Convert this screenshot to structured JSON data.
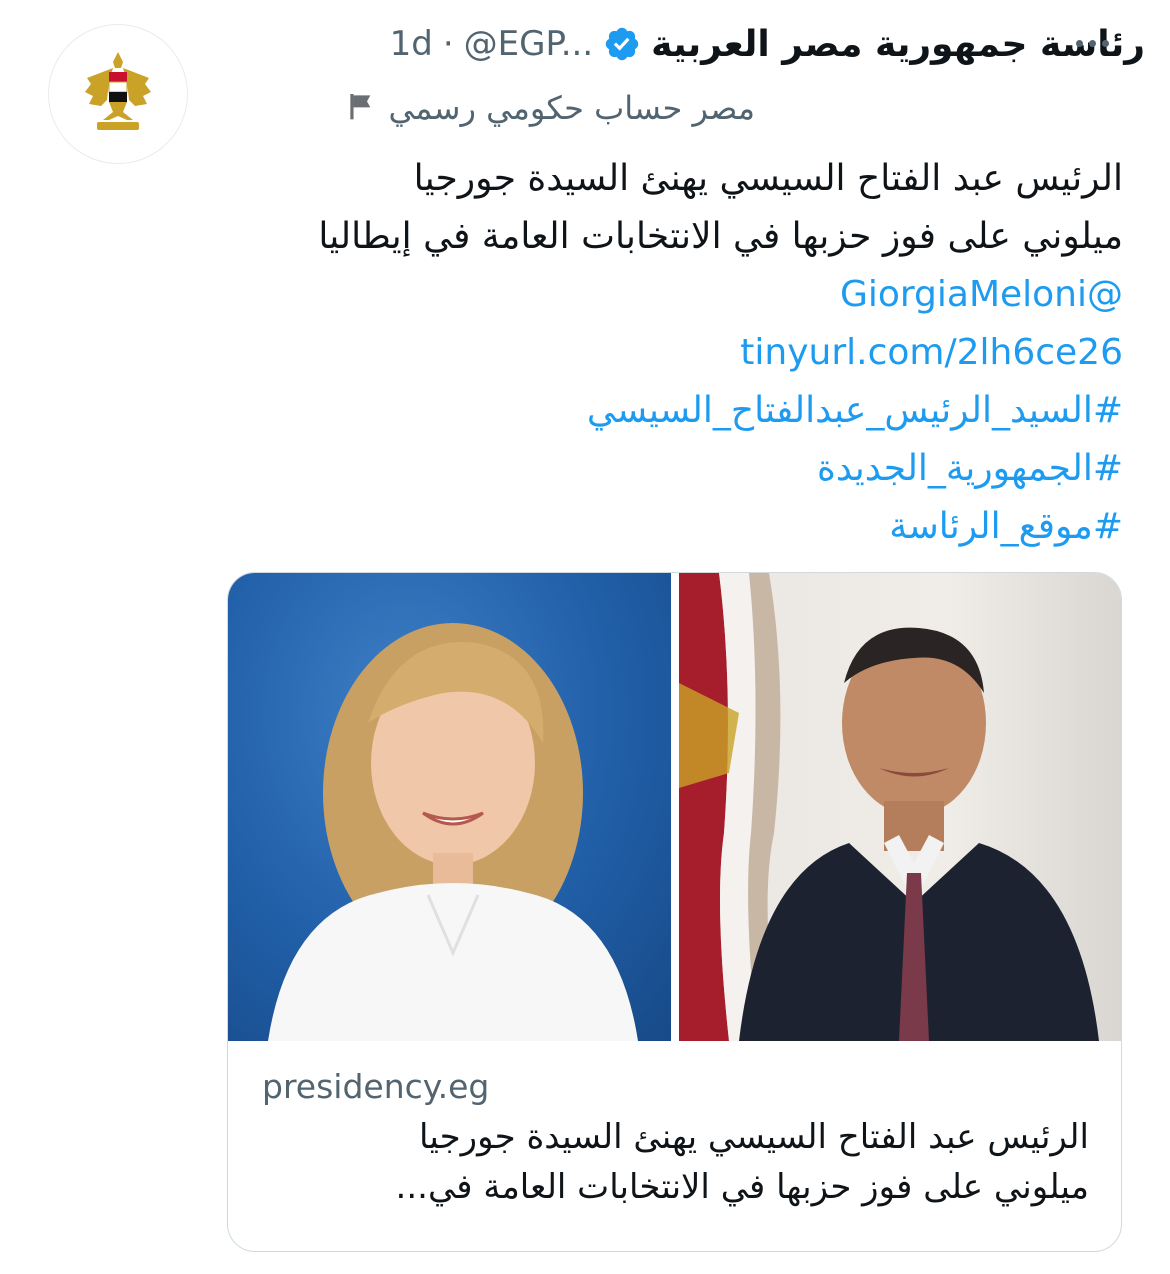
{
  "author": {
    "display_name": "رئاسة جمهورية مصر العربية",
    "handle": "@EGP...",
    "separator": "·",
    "time": "1d",
    "avatar_icon": "egypt-eagle-emblem-icon",
    "verified_icon": "verified-badge-icon"
  },
  "label": {
    "text": "مصر حساب حكومي رسمي",
    "icon": "flag-icon"
  },
  "tweet": {
    "line1": "الرئيس عبد الفتاح السيسي يهنئ السيدة جورجيا",
    "line2": "ميلوني على فوز حزبها في الانتخابات العامة في إيطاليا",
    "mention": "@GiorgiaMeloni",
    "url": "tinyurl.com/2lh6ce26",
    "hashtags": [
      "#السيد_الرئيس_عبدالفتاح_السيسي",
      "#الجمهورية_الجديدة",
      "#موقع_الرئاسة"
    ]
  },
  "card": {
    "domain": "presidency.eg",
    "title_line1": "الرئيس عبد الفتاح السيسي يهنئ السيدة جورجيا",
    "title_line2": "ميلوني على فوز حزبها في الانتخابات العامة في..."
  },
  "colors": {
    "link": "#1d9bf0",
    "secondary_text": "#536471",
    "primary_text": "#0f1419",
    "border": "#cfd9de"
  }
}
